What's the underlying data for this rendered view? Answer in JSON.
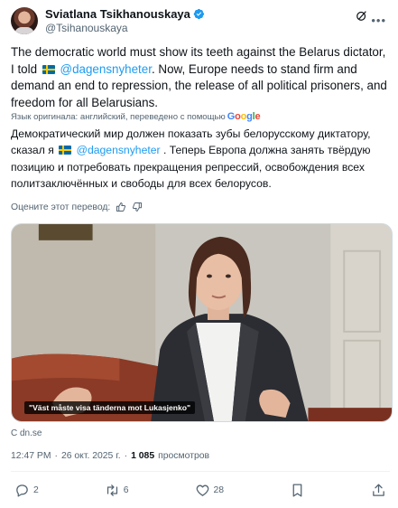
{
  "author": {
    "display_name": "Sviatlana Tsikhanouskaya",
    "handle": "@Tsihanouskaya"
  },
  "post": {
    "text_before_mention": "The democratic world must show its teeth against the Belarus dictator, I told ",
    "mention": "@dagensnyheter",
    "text_after_mention": ". Now, Europe needs to stand firm and demand an end to repression, the release of all political prisoners, and freedom for all Belarusians."
  },
  "translation": {
    "note": "Язык оригинала: английский, переведено с помощью",
    "provider": "Google",
    "text_before_mention": "Демократический мир должен показать зубы белорусскому диктатору, сказал я ",
    "mention": "@dagensnyheter",
    "text_after_mention": " . Теперь Европа должна занять твёрдую позицию и потребовать прекращения репрессий, освобождения всех политзаключённых и свободы для всех белорусов.",
    "rate_label": "Оцените этот перевод:"
  },
  "media": {
    "caption": "\"Väst måste visa tänderna mot Lukasjenko\""
  },
  "link_card": {
    "source": "С dn.se"
  },
  "meta": {
    "time": "12:47 PM",
    "separator": "·",
    "date": "26 окт. 2025 г.",
    "views_count": "1 085",
    "views_label": "просмотров"
  },
  "actions": {
    "replies": "2",
    "reposts": "6",
    "likes": "28"
  },
  "colors": {
    "accent": "#1d9bf0",
    "text": "#0f1419",
    "muted": "#536471",
    "verified": "#1d9bf0"
  },
  "icons": [
    "verified-badge-icon",
    "grok-icon",
    "more-icon",
    "thumbs-up-icon",
    "thumbs-down-icon",
    "reply-icon",
    "repost-icon",
    "like-icon",
    "bookmark-icon",
    "share-icon"
  ]
}
